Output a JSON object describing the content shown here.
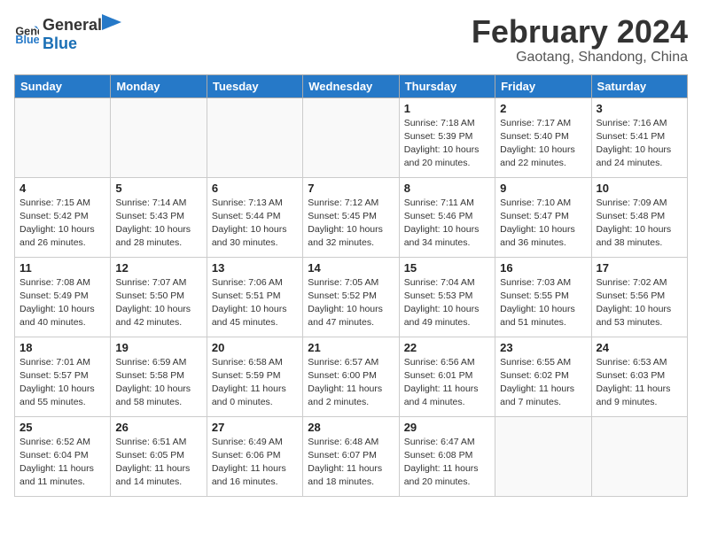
{
  "header": {
    "logo_general": "General",
    "logo_blue": "Blue",
    "title": "February 2024",
    "subtitle": "Gaotang, Shandong, China"
  },
  "days_of_week": [
    "Sunday",
    "Monday",
    "Tuesday",
    "Wednesday",
    "Thursday",
    "Friday",
    "Saturday"
  ],
  "weeks": [
    [
      {
        "day": "",
        "info": ""
      },
      {
        "day": "",
        "info": ""
      },
      {
        "day": "",
        "info": ""
      },
      {
        "day": "",
        "info": ""
      },
      {
        "day": "1",
        "info": "Sunrise: 7:18 AM\nSunset: 5:39 PM\nDaylight: 10 hours\nand 20 minutes."
      },
      {
        "day": "2",
        "info": "Sunrise: 7:17 AM\nSunset: 5:40 PM\nDaylight: 10 hours\nand 22 minutes."
      },
      {
        "day": "3",
        "info": "Sunrise: 7:16 AM\nSunset: 5:41 PM\nDaylight: 10 hours\nand 24 minutes."
      }
    ],
    [
      {
        "day": "4",
        "info": "Sunrise: 7:15 AM\nSunset: 5:42 PM\nDaylight: 10 hours\nand 26 minutes."
      },
      {
        "day": "5",
        "info": "Sunrise: 7:14 AM\nSunset: 5:43 PM\nDaylight: 10 hours\nand 28 minutes."
      },
      {
        "day": "6",
        "info": "Sunrise: 7:13 AM\nSunset: 5:44 PM\nDaylight: 10 hours\nand 30 minutes."
      },
      {
        "day": "7",
        "info": "Sunrise: 7:12 AM\nSunset: 5:45 PM\nDaylight: 10 hours\nand 32 minutes."
      },
      {
        "day": "8",
        "info": "Sunrise: 7:11 AM\nSunset: 5:46 PM\nDaylight: 10 hours\nand 34 minutes."
      },
      {
        "day": "9",
        "info": "Sunrise: 7:10 AM\nSunset: 5:47 PM\nDaylight: 10 hours\nand 36 minutes."
      },
      {
        "day": "10",
        "info": "Sunrise: 7:09 AM\nSunset: 5:48 PM\nDaylight: 10 hours\nand 38 minutes."
      }
    ],
    [
      {
        "day": "11",
        "info": "Sunrise: 7:08 AM\nSunset: 5:49 PM\nDaylight: 10 hours\nand 40 minutes."
      },
      {
        "day": "12",
        "info": "Sunrise: 7:07 AM\nSunset: 5:50 PM\nDaylight: 10 hours\nand 42 minutes."
      },
      {
        "day": "13",
        "info": "Sunrise: 7:06 AM\nSunset: 5:51 PM\nDaylight: 10 hours\nand 45 minutes."
      },
      {
        "day": "14",
        "info": "Sunrise: 7:05 AM\nSunset: 5:52 PM\nDaylight: 10 hours\nand 47 minutes."
      },
      {
        "day": "15",
        "info": "Sunrise: 7:04 AM\nSunset: 5:53 PM\nDaylight: 10 hours\nand 49 minutes."
      },
      {
        "day": "16",
        "info": "Sunrise: 7:03 AM\nSunset: 5:55 PM\nDaylight: 10 hours\nand 51 minutes."
      },
      {
        "day": "17",
        "info": "Sunrise: 7:02 AM\nSunset: 5:56 PM\nDaylight: 10 hours\nand 53 minutes."
      }
    ],
    [
      {
        "day": "18",
        "info": "Sunrise: 7:01 AM\nSunset: 5:57 PM\nDaylight: 10 hours\nand 55 minutes."
      },
      {
        "day": "19",
        "info": "Sunrise: 6:59 AM\nSunset: 5:58 PM\nDaylight: 10 hours\nand 58 minutes."
      },
      {
        "day": "20",
        "info": "Sunrise: 6:58 AM\nSunset: 5:59 PM\nDaylight: 11 hours\nand 0 minutes."
      },
      {
        "day": "21",
        "info": "Sunrise: 6:57 AM\nSunset: 6:00 PM\nDaylight: 11 hours\nand 2 minutes."
      },
      {
        "day": "22",
        "info": "Sunrise: 6:56 AM\nSunset: 6:01 PM\nDaylight: 11 hours\nand 4 minutes."
      },
      {
        "day": "23",
        "info": "Sunrise: 6:55 AM\nSunset: 6:02 PM\nDaylight: 11 hours\nand 7 minutes."
      },
      {
        "day": "24",
        "info": "Sunrise: 6:53 AM\nSunset: 6:03 PM\nDaylight: 11 hours\nand 9 minutes."
      }
    ],
    [
      {
        "day": "25",
        "info": "Sunrise: 6:52 AM\nSunset: 6:04 PM\nDaylight: 11 hours\nand 11 minutes."
      },
      {
        "day": "26",
        "info": "Sunrise: 6:51 AM\nSunset: 6:05 PM\nDaylight: 11 hours\nand 14 minutes."
      },
      {
        "day": "27",
        "info": "Sunrise: 6:49 AM\nSunset: 6:06 PM\nDaylight: 11 hours\nand 16 minutes."
      },
      {
        "day": "28",
        "info": "Sunrise: 6:48 AM\nSunset: 6:07 PM\nDaylight: 11 hours\nand 18 minutes."
      },
      {
        "day": "29",
        "info": "Sunrise: 6:47 AM\nSunset: 6:08 PM\nDaylight: 11 hours\nand 20 minutes."
      },
      {
        "day": "",
        "info": ""
      },
      {
        "day": "",
        "info": ""
      }
    ]
  ]
}
